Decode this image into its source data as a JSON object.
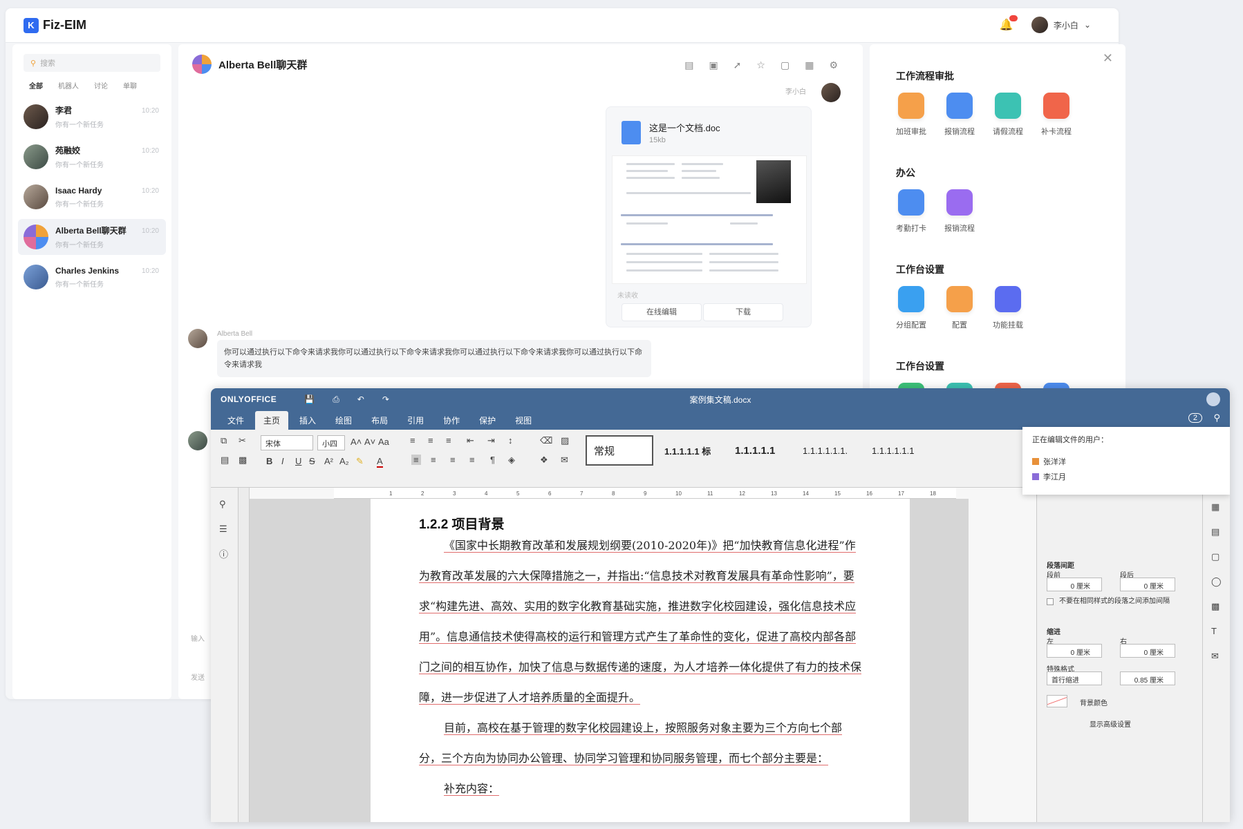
{
  "app": {
    "title": "Fiz-EIM",
    "user_name": "李小白",
    "notify_color": "#f0453d"
  },
  "sidebar": {
    "search_placeholder": "搜索",
    "filters": [
      "全部",
      "机器人",
      "讨论",
      "单聊"
    ],
    "conversations": [
      {
        "name": "李君",
        "preview": "你有一个新任务",
        "time": "10:20"
      },
      {
        "name": "苑融姣",
        "preview": "你有一个新任务",
        "time": "10:20"
      },
      {
        "name": "Isaac Hardy",
        "preview": "你有一个新任务",
        "time": "10:20"
      },
      {
        "name": "Alberta Bell聊天群",
        "preview": "你有一个新任务",
        "time": "10:20"
      },
      {
        "name": "Charles Jenkins",
        "preview": "你有一个新任务",
        "time": "10:20"
      }
    ]
  },
  "chat": {
    "title": "Alberta Bell聊天群",
    "self_name": "李小白",
    "file": {
      "name": "这是一个文档.doc",
      "size": "15kb",
      "unread": "未读收",
      "btn_edit": "在线编辑",
      "btn_download": "下载"
    },
    "msg_sender": "Alberta Bell",
    "msg_text": "你可以通过执行以下命令来请求我你可以通过执行以下命令来请求我你可以通过执行以下命令来请求我你可以通过执行以下命令来请求我",
    "input_hint": "输入",
    "send_hint": "发送"
  },
  "workbench": {
    "sections": [
      {
        "title": "工作流程审批",
        "apps": [
          {
            "label": "加班审批",
            "color": "#f5a04a"
          },
          {
            "label": "报销流程",
            "color": "#4d8df0"
          },
          {
            "label": "请假流程",
            "color": "#3cc2b3"
          },
          {
            "label": "补卡流程",
            "color": "#f0654a"
          }
        ]
      },
      {
        "title": "办公",
        "apps": [
          {
            "label": "考勤打卡",
            "color": "#4d8df0"
          },
          {
            "label": "报销流程",
            "color": "#9a6cf0"
          }
        ]
      },
      {
        "title": "工作台设置",
        "apps": [
          {
            "label": "分组配置",
            "color": "#3aa0f0"
          },
          {
            "label": "配置",
            "color": "#f5a04a"
          },
          {
            "label": "功能挂载",
            "color": "#5b6cf0"
          }
        ]
      },
      {
        "title": "工作台设置",
        "apps": [
          {
            "label": "",
            "color": "#3cc27a"
          },
          {
            "label": "",
            "color": "#3cc2b3"
          },
          {
            "label": "",
            "color": "#f0654a"
          },
          {
            "label": "",
            "color": "#4d8df0"
          }
        ]
      }
    ]
  },
  "editor": {
    "brand": "ONLYOFFICE",
    "doc_title": "案例集文稿.docx",
    "tabs": [
      "文件",
      "主页",
      "插入",
      "绘图",
      "布局",
      "引用",
      "协作",
      "保护",
      "视图"
    ],
    "font": "宋体",
    "size": "小四",
    "styles": [
      "常规",
      "1.1.1.1.1 标",
      "1.1.1.1.1",
      "1.1.1.1.1.1.",
      "1.1.1.1.1.1"
    ],
    "heading": "1.2.2  项目背景",
    "paragraph1": "《国家中长期教育改革和发展规划纲要(2010-2020年)》把“加快教育信息化进程”作为教育改革发展的六大保障措施之一，并指出:“信息技术对教育发展具有革命性影响”，要求“构建先进、高效、实用的数字化教育基础实施，推进数字化校园建设，强化信息技术应用”。信息通信技术使得高校的运行和管理方式产生了革命性的变化，促进了高校内部各部门之间的相互协作，加快了信息与数据传递的速度，为人才培养一体化提供了有力的技术保障，进一步促进了人才培养质量的全面提升。",
    "paragraph2": "目前，高校在基于管理的数字化校园建设上，按照服务对象主要为三个方向七个部分，三个方向为协同办公管理、协同学习管理和协同服务管理，而七个部分主要是：",
    "paragraph3": "补充内容：",
    "editing_title": "正在编辑文件的用户：",
    "editors": [
      {
        "name": "张洋洋",
        "color": "#e8913a"
      },
      {
        "name": "李江月",
        "color": "#8a6cd8"
      }
    ],
    "side": {
      "spacing": "段落间距",
      "before": "段前",
      "after": "段后",
      "before_val": "0 厘米",
      "after_val": "0 厘米",
      "no_space": "不要在相同样式的段落之间添加间隔",
      "indent": "缩进",
      "left": "左",
      "right": "右",
      "left_val": "0 厘米",
      "right_val": "0 厘米",
      "special": "特殊格式",
      "special_val": "首行缩进",
      "special_amt": "0.85 厘米",
      "bg": "背景颜色",
      "adv": "显示高级设置"
    },
    "ruler": [
      "1",
      "2",
      "3",
      "4",
      "5",
      "6",
      "7",
      "8",
      "9",
      "10",
      "11",
      "12",
      "13",
      "14",
      "15",
      "16",
      "17",
      "18"
    ],
    "collab_count": "2"
  }
}
